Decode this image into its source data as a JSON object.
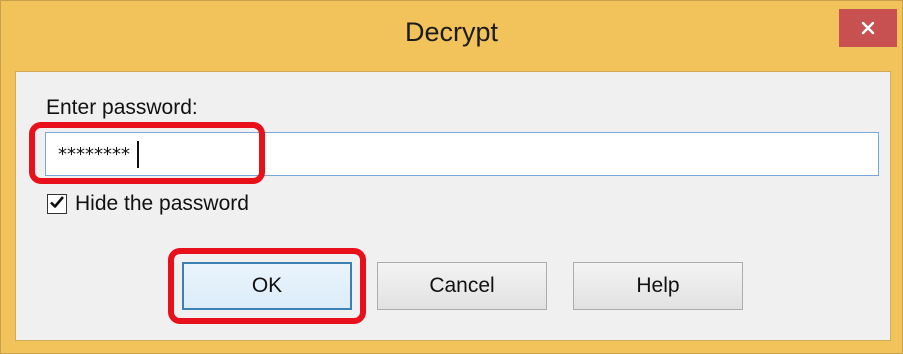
{
  "window": {
    "title": "Decrypt"
  },
  "form": {
    "password_label": "Enter password:",
    "password_value": "********",
    "hide_password_label": "Hide the password",
    "hide_password_checked": true
  },
  "buttons": {
    "ok": "OK",
    "cancel": "Cancel",
    "help": "Help"
  },
  "colors": {
    "title_bar": "#f1c35a",
    "close_button": "#c75050",
    "highlight": "#e8101a"
  },
  "icons": {
    "close": "close-icon",
    "checkmark": "checkmark-icon"
  }
}
